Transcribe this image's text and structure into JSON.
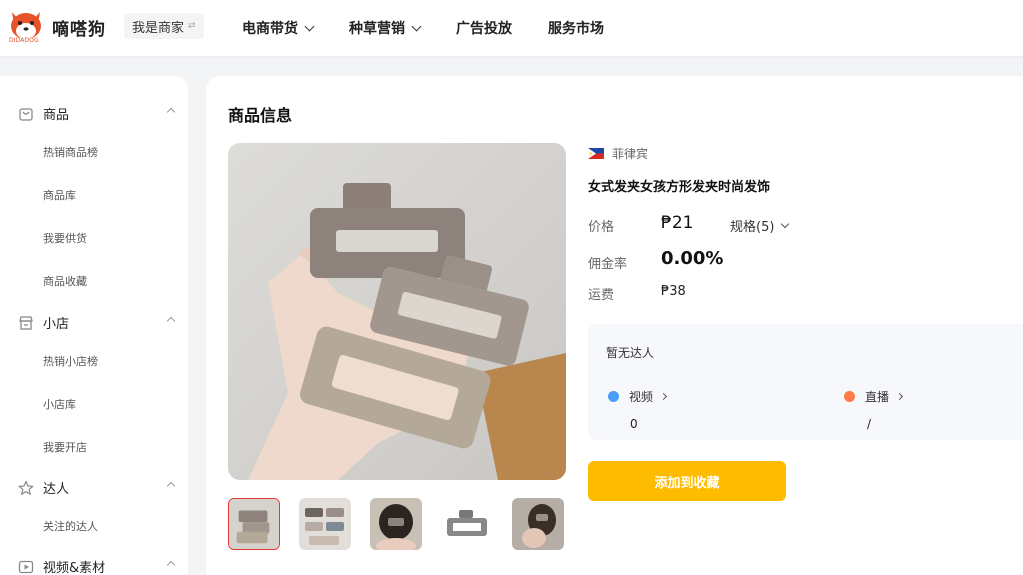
{
  "header": {
    "brand": "嘀嗒狗",
    "logo_sub": "DIDADOG",
    "merchant": "我是商家",
    "nav": [
      "电商带货",
      "种草营销",
      "广告投放",
      "服务市场"
    ]
  },
  "sidebar": {
    "sections": [
      {
        "label": "商品",
        "icon": "shopping-bag-icon",
        "items": [
          "热销商品榜",
          "商品库",
          "我要供货",
          "商品收藏"
        ]
      },
      {
        "label": "小店",
        "icon": "store-icon",
        "items": [
          "热销小店榜",
          "小店库",
          "我要开店"
        ]
      },
      {
        "label": "达人",
        "icon": "star-icon",
        "items": [
          "关注的达人"
        ]
      },
      {
        "label": "视频&素材",
        "icon": "video-icon",
        "items": []
      }
    ]
  },
  "product": {
    "section_title": "商品信息",
    "country": "菲律宾",
    "name": "女式发夹女孩方形发夹时尚发饰",
    "price_label": "价格",
    "price": "₱21",
    "spec": "规格(5)",
    "commission_label": "佣金率",
    "commission": "0.00%",
    "shipping_label": "运费",
    "shipping": "₱38",
    "talent": {
      "empty_text": "暂无达人",
      "video_label": "视频",
      "video_value": "0",
      "live_label": "直播",
      "live_value": "/"
    },
    "add_button": "添加到收藏"
  },
  "colors": {
    "accent": "#ffbb00",
    "brand": "#e8532b"
  }
}
